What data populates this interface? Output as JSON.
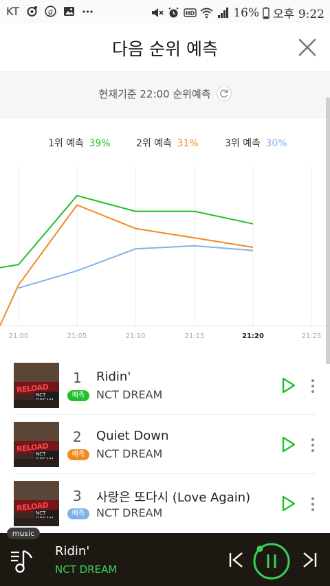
{
  "status_bar": {
    "carrier": "KT",
    "battery": "16%",
    "time": "오후 9:22",
    "left_icons": [
      "music-note-icon",
      "g-icon",
      "gallery-icon",
      "more-dots-icon"
    ],
    "right_icons": [
      "mute-icon",
      "alarm-icon",
      "hd-icon",
      "wifi-icon",
      "signal-icon"
    ]
  },
  "header": {
    "title": "다음 순위 예측",
    "close_icon": "close-icon"
  },
  "subheader": {
    "text": "현재기준 22:00 순위예측",
    "refresh_icon": "refresh-icon"
  },
  "legend": {
    "items": [
      {
        "label": "1위 예측",
        "value": "39%",
        "color": "#1fbf2d"
      },
      {
        "label": "2위 예측",
        "value": "31%",
        "color": "#f08a22"
      },
      {
        "label": "3위 예측",
        "value": "30%",
        "color": "#7fb2e8"
      }
    ]
  },
  "chart_data": {
    "type": "line",
    "x": [
      "20:57",
      "21:00",
      "21:05",
      "21:10",
      "21:15",
      "21:20"
    ],
    "x_tick_labels": [
      "21:00",
      "21:05",
      "21:10",
      "21:15",
      "21:20",
      "21:25"
    ],
    "highlight_tick": "21:20",
    "y_range": [
      0,
      100
    ],
    "grid": "vertical",
    "series": [
      {
        "name": "1위 예측",
        "color": "#1fbf2d",
        "values": [
          37,
          39,
          83,
          73,
          73,
          65
        ]
      },
      {
        "name": "2위 예측",
        "color": "#f08a22",
        "values": [
          0,
          26,
          77,
          62,
          56,
          50
        ]
      },
      {
        "name": "3위 예측",
        "color": "#7fb2e8",
        "values": [
          null,
          24,
          35,
          49,
          51,
          48
        ]
      }
    ]
  },
  "songs": [
    {
      "rank": "1",
      "title": "Ridin'",
      "artist": "NCT DREAM",
      "badge": "예측",
      "badge_color": "#1fbf2d",
      "cover_text": "RELOAD",
      "cover_sub": "NCT DREAM"
    },
    {
      "rank": "2",
      "title": "Quiet Down",
      "artist": "NCT DREAM",
      "badge": "예측",
      "badge_color": "#f08a22",
      "cover_text": "RELOAD",
      "cover_sub": "NCT DREAM"
    },
    {
      "rank": "3",
      "title": "사랑은 또다시 (Love Again)",
      "artist": "NCT DREAM",
      "badge": "예측",
      "badge_color": "#7fb2e8",
      "cover_text": "RELOAD",
      "cover_sub": "NCT DREAM"
    }
  ],
  "player": {
    "tag": "music",
    "title": "Ridin'",
    "artist": "NCT DREAM",
    "accent": "#3ad05a",
    "progress": 0.12
  }
}
